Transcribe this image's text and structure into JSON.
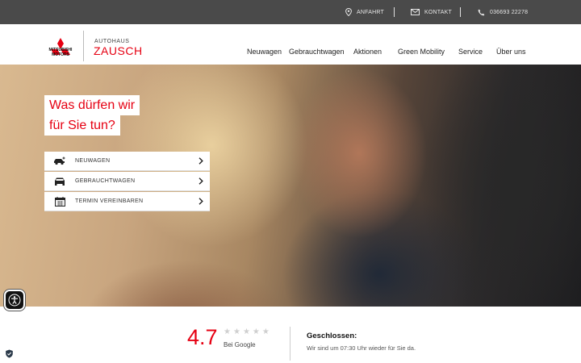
{
  "topbar": {
    "directions": {
      "label": "ANFAHRT",
      "icon": "location-pin-icon"
    },
    "contact": {
      "label": "KONTAKT",
      "icon": "envelope-icon"
    },
    "phone": {
      "label": "036693 22278",
      "icon": "phone-icon"
    }
  },
  "brand": {
    "logo_text_line1": "MITSUBISHI",
    "logo_text_line2": "MOTORS",
    "dealer_small": "AUTOHAUS",
    "dealer_name": "ZAUSCH"
  },
  "nav": {
    "items": [
      {
        "label": "Neuwagen"
      },
      {
        "label": "Gebrauchtwagen"
      },
      {
        "label": "Aktionen"
      },
      {
        "label": "Green Mobility"
      },
      {
        "label": "Service"
      },
      {
        "label": "Über uns"
      }
    ]
  },
  "hero": {
    "title_line1": "Was dürfen wir",
    "title_line2": "für Sie tun?",
    "links": [
      {
        "label": "NEUWAGEN",
        "icon": "new-car-icon"
      },
      {
        "label": "GEBRAUCHTWAGEN",
        "icon": "used-car-icon"
      },
      {
        "label": "TERMIN VEREINBAREN",
        "icon": "calendar-icon"
      }
    ]
  },
  "rating": {
    "score": "4.7",
    "stars_filled": 0,
    "stars_total": 5,
    "source": "Bei Google"
  },
  "opening": {
    "title": "Geschlossen:",
    "text": "Wir sind um 07:30 Uhr wieder für Sie da."
  },
  "colors": {
    "brand_red": "#e60012",
    "topbar_bg": "#4a4a4a"
  }
}
